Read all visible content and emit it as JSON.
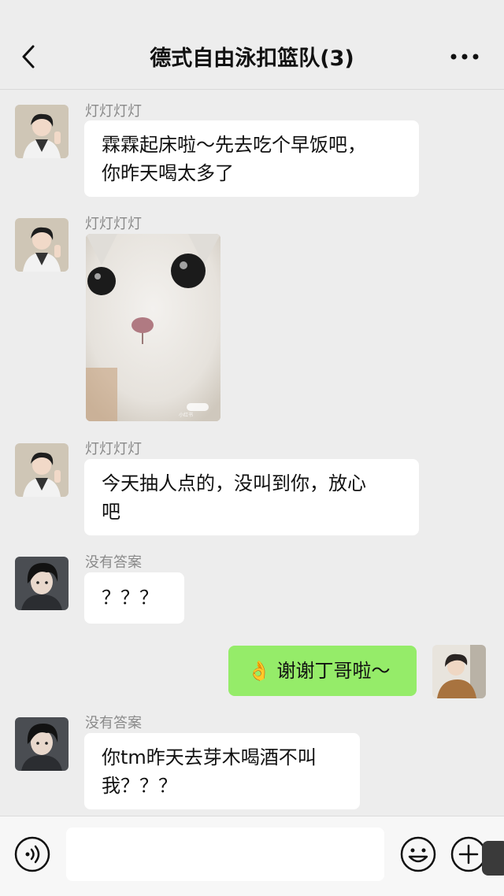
{
  "header": {
    "title": "德式自由泳扣篮队(3)"
  },
  "colors": {
    "background": "#ededed",
    "bubble_received": "#ffffff",
    "bubble_sent": "#95ec69",
    "sender_name": "#8a8a8a"
  },
  "messages": [
    {
      "sender": "灯灯灯灯",
      "type": "text",
      "lines": [
        "霖霖起床啦～先去吃个早饭吧，",
        "你昨天喝太多了"
      ]
    },
    {
      "sender": "灯灯灯灯",
      "type": "image",
      "image": "cat-face-photo",
      "watermark": "小红书"
    },
    {
      "sender": "灯灯灯灯",
      "type": "text",
      "lines": [
        "今天抽人点的，没叫到你，放心",
        "吧"
      ]
    },
    {
      "sender": "没有答案",
      "type": "text",
      "lines": [
        "？？？"
      ]
    },
    {
      "sender": "",
      "type": "text",
      "direction": "sent",
      "emoji": "👌",
      "lines": [
        "谢谢丁哥啦～"
      ]
    },
    {
      "sender": "没有答案",
      "type": "text",
      "lines": [
        "你tm昨天去芽木喝酒不叫",
        "我？？？"
      ]
    }
  ],
  "icons": {
    "back": "chevron-left-icon",
    "more": "more-dots-icon",
    "voice": "voice-icon",
    "emoji": "emoji-icon",
    "plus": "plus-icon"
  }
}
